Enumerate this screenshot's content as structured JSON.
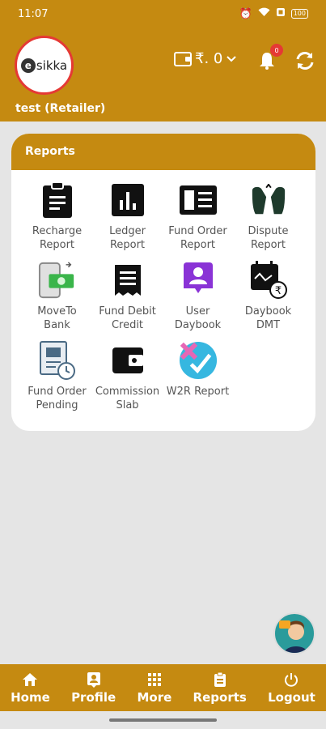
{
  "status_bar": {
    "time": "11:07",
    "battery": "100"
  },
  "header": {
    "logo_e": "e",
    "logo_text": "sikka",
    "user_name": "test (Retailer)",
    "wallet_balance": "₹. 0",
    "notification_count": "0"
  },
  "reports": {
    "title": "Reports",
    "items": [
      {
        "line1": "Recharge",
        "line2": "Report"
      },
      {
        "line1": "Ledger",
        "line2": "Report"
      },
      {
        "line1": "Fund Order",
        "line2": "Report"
      },
      {
        "line1": "Dispute",
        "line2": "Report"
      },
      {
        "line1": "MoveTo",
        "line2": "Bank"
      },
      {
        "line1": "Fund Debit",
        "line2": "Credit"
      },
      {
        "line1": "User",
        "line2": "Daybook"
      },
      {
        "line1": "Daybook",
        "line2": "DMT"
      },
      {
        "line1": "Fund Order",
        "line2": "Pending"
      },
      {
        "line1": "Commission",
        "line2": "Slab"
      },
      {
        "line1": "W2R Report",
        "line2": ""
      }
    ]
  },
  "bottom_nav": [
    {
      "label": "Home",
      "icon": "home-icon"
    },
    {
      "label": "Profile",
      "icon": "profile-icon"
    },
    {
      "label": "More",
      "icon": "grid-icon"
    },
    {
      "label": "Reports",
      "icon": "clipboard-icon"
    },
    {
      "label": "Logout",
      "icon": "power-icon"
    }
  ],
  "colors": {
    "brand": "#c58a11",
    "background": "#e5e5e5",
    "badge": "#e53935"
  }
}
